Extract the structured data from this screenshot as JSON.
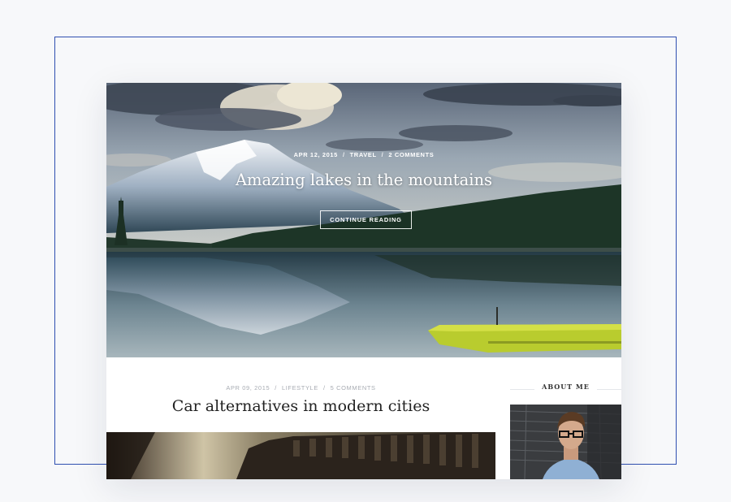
{
  "hero": {
    "date": "APR 12, 2015",
    "category": "TRAVEL",
    "comments": "2 COMMENTS",
    "separator": "/",
    "title": "Amazing lakes in the mountains",
    "button_label": "CONTINUE READING"
  },
  "post": {
    "date": "APR 09, 2015",
    "category": "LIFESTYLE",
    "comments": "5 COMMENTS",
    "separator": "/",
    "title": "Car alternatives in modern cities"
  },
  "sidebar": {
    "about_heading": "ABOUT ME"
  },
  "colors": {
    "frame_outline": "#2f4fb0",
    "kayak": "#b9cc2e",
    "title_text": "#222222",
    "meta_text": "#a8acb3"
  }
}
